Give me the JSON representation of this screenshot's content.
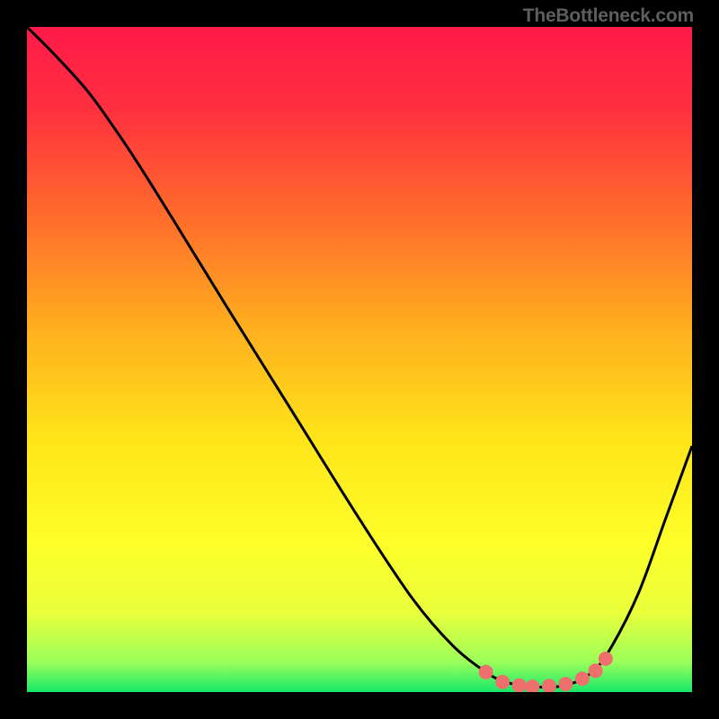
{
  "watermark": "TheBottleneck.com",
  "chart_data": {
    "type": "line",
    "title": "",
    "xlabel": "",
    "ylabel": "",
    "xlim": [
      0,
      1
    ],
    "ylim": [
      0,
      1
    ],
    "gradient_stops": [
      {
        "offset": 0.0,
        "color": "#ff1a49"
      },
      {
        "offset": 0.12,
        "color": "#ff2f3f"
      },
      {
        "offset": 0.28,
        "color": "#ff6a2c"
      },
      {
        "offset": 0.45,
        "color": "#ffae1f"
      },
      {
        "offset": 0.62,
        "color": "#ffe51a"
      },
      {
        "offset": 0.78,
        "color": "#fdff2a"
      },
      {
        "offset": 0.88,
        "color": "#e9ff3b"
      },
      {
        "offset": 0.955,
        "color": "#9bff5a"
      },
      {
        "offset": 1.0,
        "color": "#17e86a"
      }
    ],
    "series": [
      {
        "name": "bottleneck-curve",
        "stroke": "#000000",
        "x": [
          0.0,
          0.04,
          0.09,
          0.13,
          0.17,
          0.22,
          0.3,
          0.4,
          0.5,
          0.58,
          0.64,
          0.69,
          0.72,
          0.76,
          0.81,
          0.85,
          0.88,
          0.92,
          0.96,
          1.0
        ],
        "y": [
          1.0,
          0.96,
          0.905,
          0.85,
          0.79,
          0.71,
          0.58,
          0.42,
          0.26,
          0.14,
          0.07,
          0.03,
          0.015,
          0.008,
          0.01,
          0.03,
          0.07,
          0.15,
          0.26,
          0.37
        ]
      }
    ],
    "markers": {
      "color": "#ef6f6d",
      "radius": 8,
      "points": [
        {
          "x": 0.69,
          "y": 0.03
        },
        {
          "x": 0.715,
          "y": 0.015
        },
        {
          "x": 0.74,
          "y": 0.01
        },
        {
          "x": 0.76,
          "y": 0.008
        },
        {
          "x": 0.785,
          "y": 0.009
        },
        {
          "x": 0.81,
          "y": 0.012
        },
        {
          "x": 0.835,
          "y": 0.02
        },
        {
          "x": 0.855,
          "y": 0.032
        },
        {
          "x": 0.87,
          "y": 0.05
        }
      ]
    }
  }
}
